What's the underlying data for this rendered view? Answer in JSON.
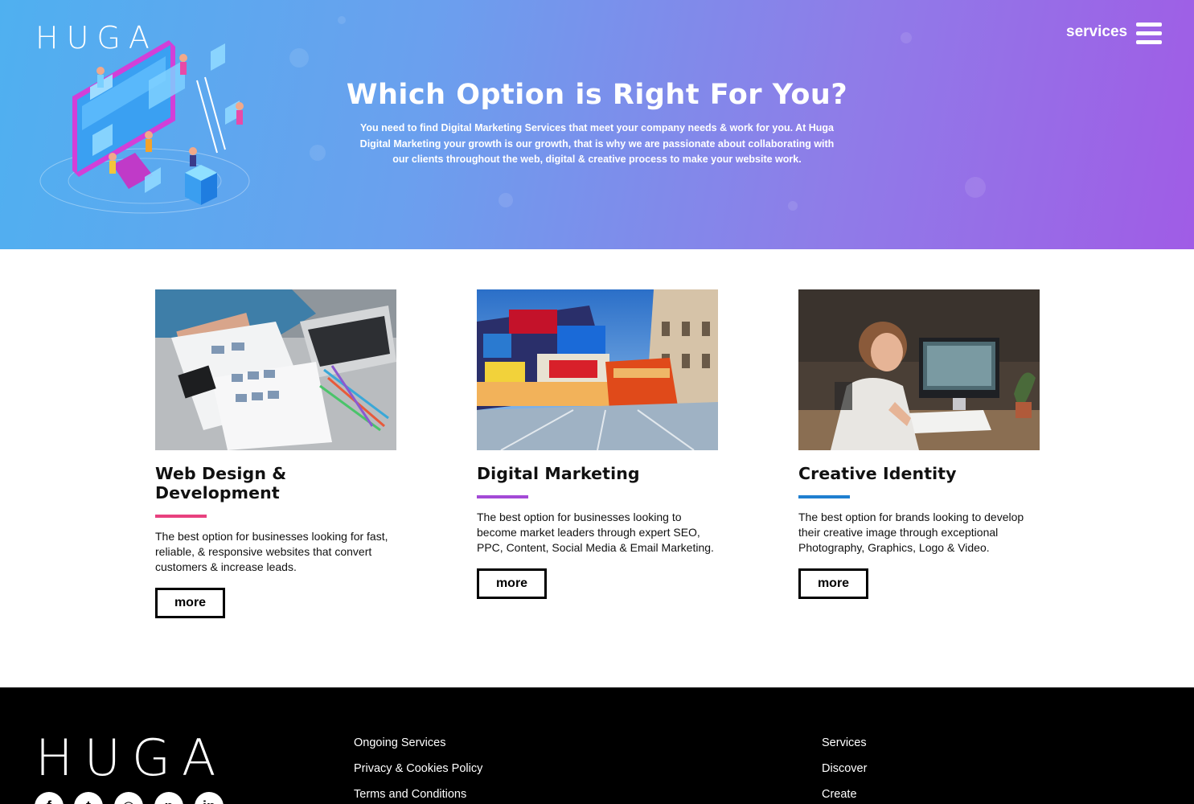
{
  "header": {
    "logo": "HUGA",
    "nav_label": "services"
  },
  "hero": {
    "title": "Which Option is Right For You?",
    "description": "You need to find Digital Marketing Services that meet your company needs & work for you. At Huga Digital Marketing your growth is our growth, that is why we are passionate about collaborating with our clients throughout the web, digital & creative process to make your website work."
  },
  "cards": [
    {
      "title": "Web Design & Development",
      "accent": "#e8417f",
      "description": "The best option for businesses looking for fast, reliable, & responsive websites that convert customers & increase leads.",
      "button": "more"
    },
    {
      "title": "Digital Marketing",
      "accent": "#a34ad6",
      "description": "The best option for businesses looking to become market leaders through expert SEO, PPC, Content, Social Media & Email Marketing.",
      "button": "more"
    },
    {
      "title": "Creative Identity",
      "accent": "#1f7fd0",
      "description": "The best option for brands looking to develop their creative image through exceptional Photography, Graphics, Logo & Video.",
      "button": "more"
    }
  ],
  "footer": {
    "logo": "HUGA",
    "social_icons": [
      "facebook-icon",
      "twitter-icon",
      "instagram-icon",
      "pinterest-icon",
      "linkedin-icon"
    ],
    "links_col1": [
      "Ongoing Services",
      "Privacy & Cookies Policy",
      "Terms and Conditions"
    ],
    "links_col2": [
      "Services",
      "Discover",
      "Create"
    ]
  }
}
